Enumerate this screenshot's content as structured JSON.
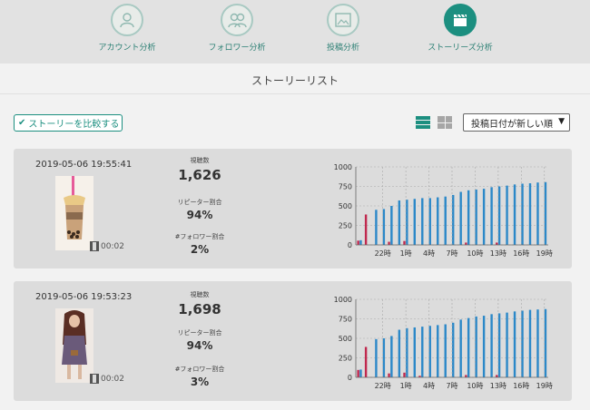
{
  "nav": {
    "items": [
      {
        "label": "アカウント分析",
        "icon": "user-icon",
        "active": false
      },
      {
        "label": "フォロワー分析",
        "icon": "users-icon",
        "active": false
      },
      {
        "label": "投稿分析",
        "icon": "image-icon",
        "active": false
      },
      {
        "label": "ストーリーズ分析",
        "icon": "clapperboard-icon",
        "active": true
      }
    ]
  },
  "page": {
    "title": "ストーリーリスト"
  },
  "toolbar": {
    "compare_label": "ストーリーを比較する",
    "sort_value": "投稿日付が新しい順"
  },
  "colors": {
    "accent": "#1c8f80",
    "bar_blue": "#2b88c8",
    "bar_red": "#c0284e"
  },
  "stories": [
    {
      "date": "2019-05-06 19:55:41",
      "duration": "00:02",
      "views_label": "視聴数",
      "views": "1,626",
      "repeat_label": "リピーター割合",
      "repeat": "94%",
      "nonfollower_label": "#フォロワー割合",
      "nonfollower": "2%",
      "thumbnail": "bubble-tea-photo"
    },
    {
      "date": "2019-05-06 19:53:23",
      "duration": "00:02",
      "views_label": "視聴数",
      "views": "1,698",
      "repeat_label": "リピーター割合",
      "repeat": "94%",
      "nonfollower_label": "#フォロワー割合",
      "nonfollower": "3%",
      "thumbnail": "woman-photo"
    }
  ],
  "chart_data": [
    {
      "type": "bar",
      "ylim": [
        0,
        1000
      ],
      "y_ticks": [
        0,
        250,
        500,
        750,
        1000
      ],
      "x_tick_labels": [
        "22時",
        "1時",
        "4時",
        "7時",
        "10時",
        "13時",
        "16時",
        "19時"
      ],
      "series": [
        {
          "color": "#2b88c8",
          "values": [
            60,
            0,
            450,
            460,
            500,
            570,
            580,
            590,
            600,
            600,
            610,
            620,
            640,
            680,
            700,
            710,
            720,
            740,
            750,
            760,
            775,
            785,
            790,
            800,
            805
          ]
        },
        {
          "color": "#c0284e",
          "values": [
            55,
            390,
            0,
            0,
            40,
            0,
            50,
            0,
            0,
            0,
            0,
            0,
            0,
            0,
            30,
            0,
            0,
            0,
            30,
            0,
            0,
            0,
            0,
            0,
            0
          ]
        }
      ]
    },
    {
      "type": "bar",
      "ylim": [
        0,
        1000
      ],
      "y_ticks": [
        0,
        250,
        500,
        750,
        1000
      ],
      "x_tick_labels": [
        "22時",
        "1時",
        "4時",
        "7時",
        "10時",
        "13時",
        "16時",
        "19時"
      ],
      "series": [
        {
          "color": "#2b88c8",
          "values": [
            100,
            0,
            490,
            500,
            530,
            610,
            630,
            640,
            650,
            660,
            670,
            680,
            700,
            740,
            760,
            780,
            790,
            810,
            820,
            830,
            845,
            855,
            865,
            870,
            875
          ]
        },
        {
          "color": "#c0284e",
          "values": [
            95,
            390,
            0,
            0,
            50,
            0,
            60,
            0,
            20,
            0,
            0,
            0,
            0,
            0,
            30,
            0,
            0,
            0,
            30,
            0,
            0,
            0,
            0,
            0,
            0
          ]
        }
      ]
    }
  ]
}
